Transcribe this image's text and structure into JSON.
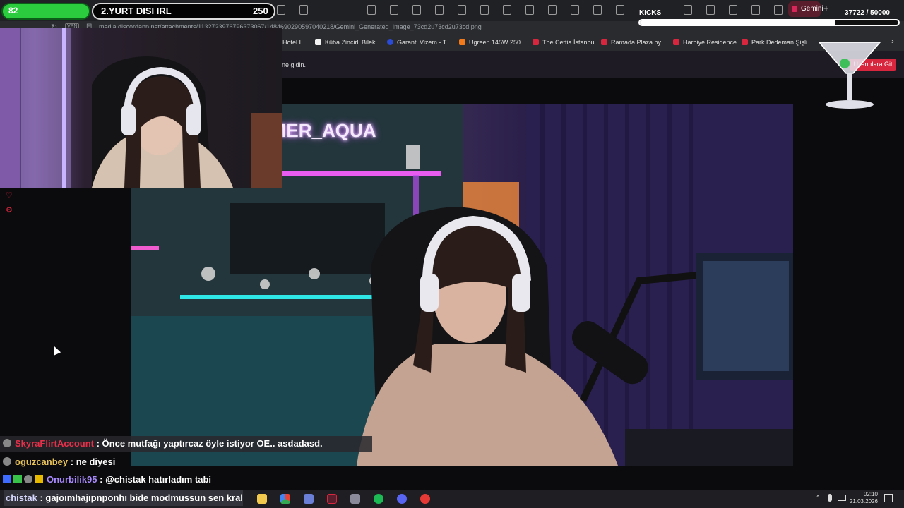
{
  "browser": {
    "active_tab_label": "Gemini",
    "new_tab_symbol": "+",
    "vpn_label": "VPN",
    "url": "media.discordapp.net/attachments/1132723976796373067/1484690290597040218/Gemini_Generated_Image_73cd2u73cd2u73cd.png",
    "bookmarks": [
      {
        "label": "Hotel I...",
        "color": "#3a3a3a"
      },
      {
        "label": "Küba Zincirli Bilekl...",
        "color": "#f3f3f3"
      },
      {
        "label": "Garanti Vizem - T...",
        "color": "#2a4bd7"
      },
      {
        "label": "Ugreen 145W 250...",
        "color": "#f27a1a"
      },
      {
        "label": "The Cettia İstanbul",
        "color": "#d7263d"
      },
      {
        "label": "Ramada Plaza by...",
        "color": "#d7263d"
      },
      {
        "label": "Harbiye Residence",
        "color": "#d7263d"
      },
      {
        "label": "Park Dedeman Şişli",
        "color": "#d7263d"
      }
    ],
    "info_text": "ne gidin.",
    "extension_button": "Uzantılara Git"
  },
  "overlay": {
    "hp_value": "82",
    "title": "2.YURT DISI IRL",
    "title_number": "250",
    "kicks_label": "KICKS",
    "kicks_count": "37722 / 50000",
    "kicks_progress": 0.754
  },
  "stream": {
    "neon_sign": "AMER_AQUA"
  },
  "chat": [
    {
      "user": "SkyraFlirtAccount",
      "user_color": "#e8304a",
      "message": ": Önce mutfağı yaptırcaz öyle istiyor OE.. asdadasd."
    },
    {
      "user": "oguzcanbey",
      "user_color": "#e8c35a",
      "message": ": ne diyesi"
    },
    {
      "user": "Onurbilik95",
      "user_color": "#a98bff",
      "message": ": @chistak hatırladım tabi"
    },
    {
      "user": "chistak",
      "user_color": "#d8d8ff",
      "message": ": gajoımhajıpnponhı bide modmussun sen kral"
    }
  ],
  "chat_mention": "@chistak",
  "taskbar": {
    "time": "02:10",
    "date": "21.03.2026"
  },
  "colors": {
    "accent": "#d7263d",
    "hp_green": "#2bcc3e"
  }
}
